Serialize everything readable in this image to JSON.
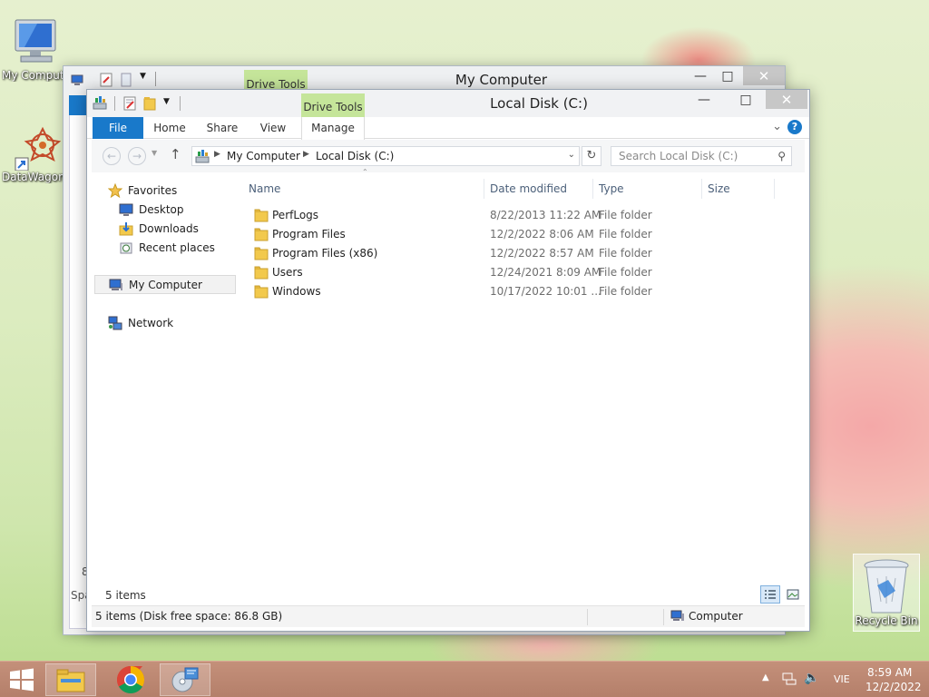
{
  "desktop": {
    "icons": [
      {
        "label": "My Computer"
      },
      {
        "label": "DataWagon"
      },
      {
        "label": "Recycle Bin"
      }
    ]
  },
  "back_window": {
    "title": "My Computer",
    "drive_tools": "Drive Tools",
    "side_chars": [
      "8",
      "Spa"
    ]
  },
  "window": {
    "title": "Local Disk (C:)",
    "drive_tools": "Drive Tools",
    "caption": {
      "minimize": "—",
      "maximize": "□",
      "close": "✕"
    },
    "tabs": {
      "file": "File",
      "home": "Home",
      "share": "Share",
      "view": "View",
      "manage": "Manage"
    },
    "breadcrumb": [
      "My Computer",
      "Local Disk (C:)"
    ],
    "search_placeholder": "Search Local Disk (C:)",
    "nav": {
      "favorites": "Favorites",
      "desktop": "Desktop",
      "downloads": "Downloads",
      "recent": "Recent places",
      "computer": "My Computer",
      "network": "Network"
    },
    "columns": {
      "name": "Name",
      "date": "Date modified",
      "type": "Type",
      "size": "Size"
    },
    "files": [
      {
        "name": "PerfLogs",
        "date": "8/22/2013 11:22 AM",
        "type": "File folder"
      },
      {
        "name": "Program Files",
        "date": "12/2/2022 8:06 AM",
        "type": "File folder"
      },
      {
        "name": "Program Files (x86)",
        "date": "12/2/2022 8:57 AM",
        "type": "File folder"
      },
      {
        "name": "Users",
        "date": "12/24/2021 8:09 AM",
        "type": "File folder"
      },
      {
        "name": "Windows",
        "date": "10/17/2022 10:01 ...",
        "type": "File folder"
      }
    ],
    "item_count": "5 items",
    "status": {
      "left": "5 items (Disk free space: 86.8 GB)",
      "right": "Computer"
    }
  },
  "taskbar": {
    "language": "VIE",
    "time": "8:59 AM",
    "date": "12/2/2022"
  },
  "colors": {
    "accent": "#1979ca",
    "drive_tools": "#c5e59a",
    "taskbar": "#b8846f"
  }
}
